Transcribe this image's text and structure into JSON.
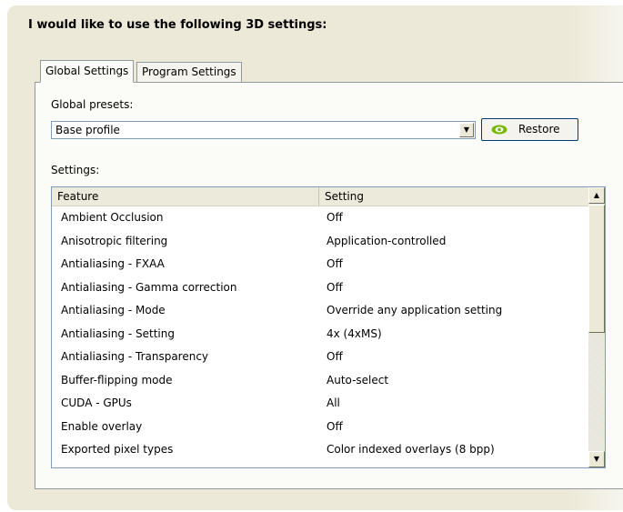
{
  "heading": "I would like to use the following 3D settings:",
  "tabs": [
    {
      "label": "Global Settings",
      "active": true
    },
    {
      "label": "Program Settings",
      "active": false
    }
  ],
  "presets": {
    "label": "Global presets:",
    "value": "Base profile",
    "restore_label": "Restore"
  },
  "settings": {
    "label": "Settings:",
    "columns": [
      "Feature",
      "Setting"
    ],
    "rows": [
      {
        "feature": "Ambient Occlusion",
        "setting": "Off"
      },
      {
        "feature": "Anisotropic filtering",
        "setting": "Application-controlled"
      },
      {
        "feature": "Antialiasing - FXAA",
        "setting": "Off"
      },
      {
        "feature": "Antialiasing - Gamma correction",
        "setting": "Off"
      },
      {
        "feature": "Antialiasing - Mode",
        "setting": "Override any application setting"
      },
      {
        "feature": "Antialiasing - Setting",
        "setting": "4x (4xMS)"
      },
      {
        "feature": "Antialiasing - Transparency",
        "setting": "Off"
      },
      {
        "feature": "Buffer-flipping mode",
        "setting": "Auto-select"
      },
      {
        "feature": "CUDA - GPUs",
        "setting": "All"
      },
      {
        "feature": "Enable overlay",
        "setting": "Off"
      },
      {
        "feature": "Exported pixel types",
        "setting": "Color indexed overlays (8 bpp)"
      }
    ]
  },
  "icons": {
    "dropdown": "chevron-down-icon",
    "restore": "nvidia-eye-icon",
    "scroll_up": "scroll-up-icon",
    "scroll_down": "scroll-down-icon"
  },
  "colors": {
    "panel": "#ece9d8",
    "tab_border": "#919b9c",
    "input_border": "#7f9db9",
    "nvidia_green": "#76b900"
  }
}
